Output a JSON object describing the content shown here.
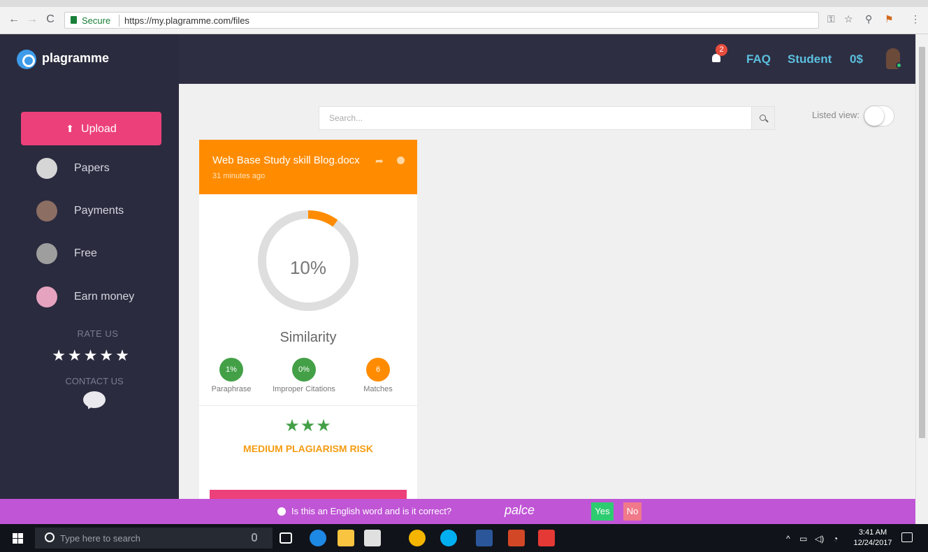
{
  "browser": {
    "secure_label": "Secure",
    "url": "https://my.plagramme.com/files"
  },
  "header": {
    "brand": "plagramme",
    "notification_count": "2",
    "faq": "FAQ",
    "student": "Student",
    "balance": "0$"
  },
  "sidebar": {
    "upload": "Upload",
    "items": [
      {
        "label": "Papers",
        "icon": "document-icon",
        "color": "#d6d6d6"
      },
      {
        "label": "Payments",
        "icon": "money-bag-icon",
        "color": "#8d6e63"
      },
      {
        "label": "Free",
        "icon": "globe-icon",
        "color": "#9e9e9e"
      },
      {
        "label": "Earn money",
        "icon": "wallet-icon",
        "color": "#e6a3c0"
      }
    ],
    "rate_us": "RATE US",
    "rate_stars": "★★★★★",
    "contact_us": "CONTACT US"
  },
  "main": {
    "search_placeholder": "Search...",
    "listed_view": "Listed view:"
  },
  "card": {
    "title": "Web Base Study skill Blog.docx",
    "time": "31 minutes ago",
    "similarity_percent": "10%",
    "similarity_value": 0.1,
    "similarity_label": "Similarity",
    "metrics": [
      {
        "value": "1%",
        "label": "Paraphrase",
        "color": "#43a047"
      },
      {
        "value": "0%",
        "label": "Improper Citations",
        "color": "#43a047"
      },
      {
        "value": "6",
        "label": "Matches",
        "color": "#ff8c00"
      }
    ],
    "risk_stars": "★★★",
    "risk": "MEDIUM PLAGIARISM RISK"
  },
  "prompt": {
    "question": "Is this an English word and is it correct?",
    "word": "palce",
    "yes": "Yes",
    "no": "No"
  },
  "taskbar": {
    "search": "Type here to search",
    "time": "3:41 AM",
    "date": "12/24/2017"
  },
  "colors": {
    "accent_pink": "#ec407a",
    "accent_orange": "#ff8c00",
    "sidebar_bg": "#2b2b3f",
    "link_blue": "#5bc0de",
    "prompt_purple": "#c055d6"
  }
}
